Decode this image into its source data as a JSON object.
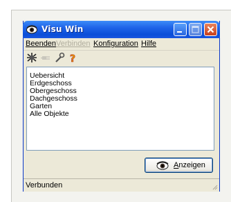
{
  "window": {
    "title": "Visu Win",
    "icon": "eye-icon",
    "controls": [
      "minimize-icon",
      "maximize-icon",
      "close-icon"
    ]
  },
  "menu": {
    "items": [
      {
        "label": "Beenden",
        "enabled": true
      },
      {
        "label": "Verbinden",
        "enabled": false
      },
      {
        "label": "Konfiguration",
        "enabled": true
      },
      {
        "label": "Hilfe",
        "enabled": true
      }
    ]
  },
  "toolbar": {
    "icons": [
      "network-icon",
      "plug-icon",
      "wrench-icon",
      "help-icon"
    ]
  },
  "list": {
    "items": [
      "Uebersicht",
      "Erdgeschoss",
      "Obergeschoss",
      "Dachgeschoss",
      "Garten",
      "Alle Objekte"
    ]
  },
  "buttons": {
    "show_label": "Anzeigen",
    "show_icon": "eye-icon"
  },
  "status": {
    "text": "Verbunden"
  },
  "colors": {
    "titlebar": "#0a4ed8",
    "window_bg": "#ece9d8",
    "disabled_text": "#b0ad9e",
    "close_button": "#c8401c"
  }
}
